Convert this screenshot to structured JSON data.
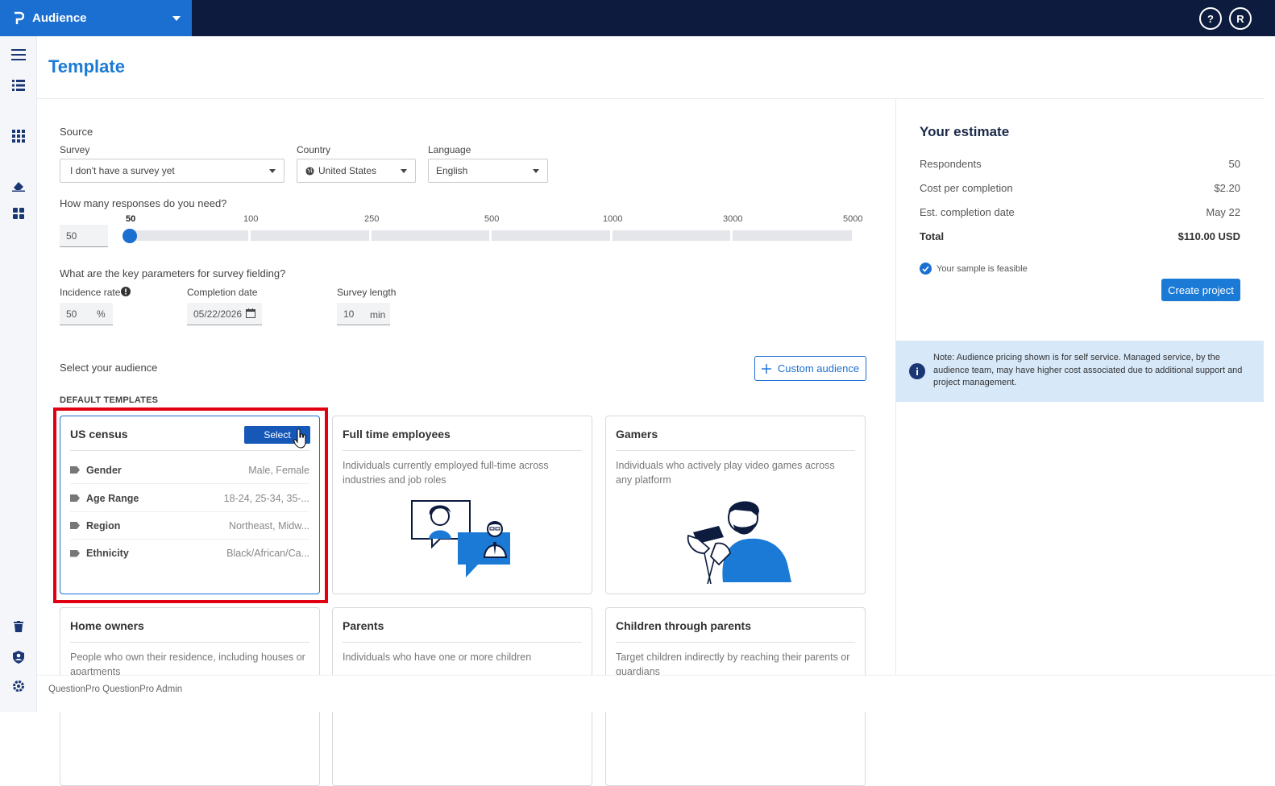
{
  "app": {
    "name": "Audience"
  },
  "topbar": {
    "help_label": "?",
    "avatar_initial": "R"
  },
  "page": {
    "title": "Template"
  },
  "form": {
    "source_label": "Source",
    "survey_label": "Survey",
    "survey_value": "I don't have a survey yet",
    "country_label": "Country",
    "country_value": "United States",
    "language_label": "Language",
    "language_value": "English",
    "responses_question": "How many responses do you need?",
    "responses_value": "50",
    "slider_ticks": [
      "50",
      "100",
      "250",
      "500",
      "1000",
      "3000",
      "5000"
    ],
    "slider_selected": "50",
    "params_question": "What are the key parameters for survey fielding?",
    "incidence_label": "Incidence rate",
    "incidence_value": "50",
    "incidence_unit": "%",
    "completion_label": "Completion date",
    "completion_value": "05/22/2026",
    "length_label": "Survey length",
    "length_value": "10",
    "length_unit": "min"
  },
  "audience": {
    "heading": "Select your audience",
    "custom_button": "Custom audience",
    "templates_heading": "DEFAULT TEMPLATES",
    "cards": [
      {
        "title": "US census",
        "select_label": "Select",
        "attributes": [
          {
            "name": "Gender",
            "value": "Male, Female"
          },
          {
            "name": "Age Range",
            "value": "18-24, 25-34, 35-..."
          },
          {
            "name": "Region",
            "value": "Northeast, Midw..."
          },
          {
            "name": "Ethnicity",
            "value": "Black/African/Ca..."
          }
        ]
      },
      {
        "title": "Full time employees",
        "description": "Individuals currently employed full-time across industries and job roles"
      },
      {
        "title": "Gamers",
        "description": "Individuals who actively play video games across any platform"
      },
      {
        "title": "Home owners",
        "description": "People who own their residence, including houses or apartments"
      },
      {
        "title": "Parents",
        "description": "Individuals who have one or more children"
      },
      {
        "title": "Children through parents",
        "description": "Target children indirectly by reaching their parents or guardians"
      }
    ]
  },
  "estimate": {
    "title": "Your estimate",
    "rows": [
      {
        "label": "Respondents",
        "value": "50"
      },
      {
        "label": "Cost per completion",
        "value": "$2.20"
      },
      {
        "label": "Est. completion date",
        "value": "May 22"
      }
    ],
    "total_label": "Total",
    "total_value": "$110.00 USD",
    "feasible_text": "Your sample is feasible",
    "create_button": "Create project",
    "note": "Note: Audience pricing shown is for self service. Managed service, by the audience team, may have higher cost associated due to additional support and project management."
  },
  "footer": {
    "text": "QuestionPro QuestionPro Admin"
  },
  "colors": {
    "navy": "#0d1b3e",
    "brand_blue": "#1b6fd1",
    "highlight_red": "#e00012"
  },
  "icons": [
    "menu-icon",
    "list-icon",
    "apps-grid-icon",
    "eraser-icon",
    "dashboard-icon",
    "trash-icon",
    "user-shield-icon",
    "gear-icon",
    "help-icon",
    "globe-icon",
    "calendar-icon",
    "info-icon",
    "check-circle-icon",
    "tag-icon",
    "plus-icon",
    "hand-cursor-icon"
  ]
}
